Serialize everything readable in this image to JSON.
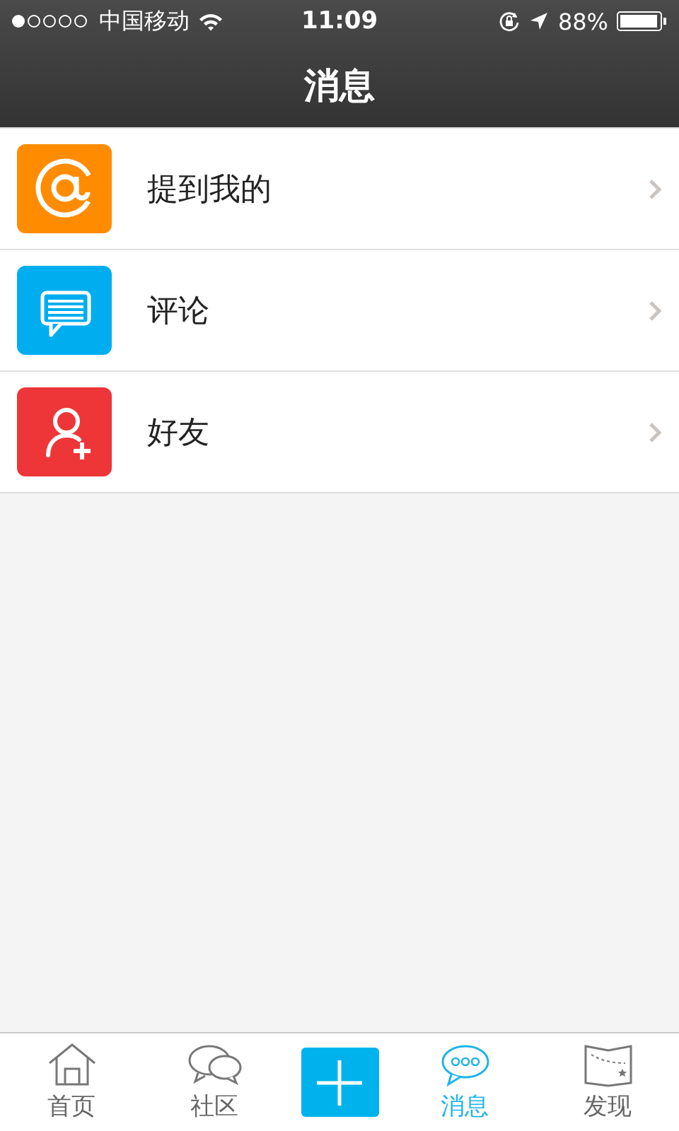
{
  "status_bar": {
    "carrier": "中国移动",
    "time": "11:09",
    "battery": "88%"
  },
  "nav": {
    "title": "消息"
  },
  "items": [
    {
      "label": "提到我的",
      "color": "#ff8c00"
    },
    {
      "label": "评论",
      "color": "#00aeef"
    },
    {
      "label": "好友",
      "color": "#ee3538"
    }
  ],
  "tabs": [
    {
      "kind": "tab",
      "label": "首页",
      "selected": false
    },
    {
      "kind": "tab",
      "label": "社区",
      "selected": false
    },
    {
      "kind": "compose"
    },
    {
      "kind": "tab",
      "label": "消息",
      "selected": true
    },
    {
      "kind": "tab",
      "label": "发现",
      "selected": false
    }
  ]
}
